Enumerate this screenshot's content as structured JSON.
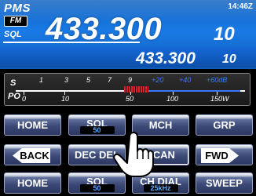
{
  "status": {
    "pms": "PMS",
    "clock": "14:46Z"
  },
  "main_band": {
    "mode": "FM",
    "sql": "SQL",
    "freq_main": "433.300",
    "freq_small": "10"
  },
  "sub_band": {
    "freq_main": "433.300",
    "freq_small": "10"
  },
  "meter": {
    "s_label": "S",
    "po_label": "PO",
    "s_scale": [
      "1",
      "3",
      "5",
      "7",
      "9"
    ],
    "s_plus_scale": [
      "+20",
      "+40",
      "+60dB"
    ],
    "po_scale": [
      "0",
      "10",
      "50",
      "100",
      "150W"
    ],
    "signal_level_fraction": 0.58
  },
  "buttons": {
    "row1": [
      {
        "label": "HOME",
        "sub": ""
      },
      {
        "label": "SQL",
        "sub": "50"
      },
      {
        "label": "MCH",
        "sub": ""
      },
      {
        "label": "GRP",
        "sub": ""
      }
    ],
    "row2": {
      "back": "BACK",
      "dec_del": "DEC DEL",
      "scan": "SCAN",
      "fwd": "FWD"
    },
    "row3": [
      {
        "label": "HOME",
        "sub": ""
      },
      {
        "label": "SQL",
        "sub": "50"
      },
      {
        "label": "CH DIAL",
        "sub": "25kHz"
      },
      {
        "label": "SWEEP",
        "sub": ""
      }
    ]
  },
  "colors": {
    "display_blue": "#1a7ae6",
    "meter_red": "#e0202a",
    "meter_blue": "#3b78ff",
    "sub_value": "#5ca8ff"
  },
  "icons": {
    "touch": "hand-pointer-icon"
  }
}
